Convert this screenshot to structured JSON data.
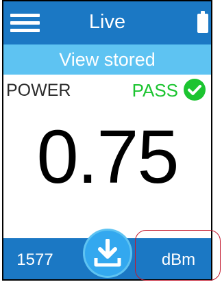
{
  "header": {
    "title": "Live",
    "menu_icon": "hamburger-menu-icon",
    "battery_icon": "battery-full-icon"
  },
  "view_stored": {
    "label": "View stored"
  },
  "measurement": {
    "label": "POWER",
    "status": "PASS",
    "status_icon": "check-circle-icon",
    "value": "0.75"
  },
  "footer": {
    "wavelength": "1577",
    "save_icon": "download-icon",
    "unit": "dBm"
  },
  "colors": {
    "primary_blue": "#1b78c4",
    "light_blue": "#5ec3f2",
    "pass_green": "#1cc430",
    "highlight_red": "#c4192e"
  }
}
